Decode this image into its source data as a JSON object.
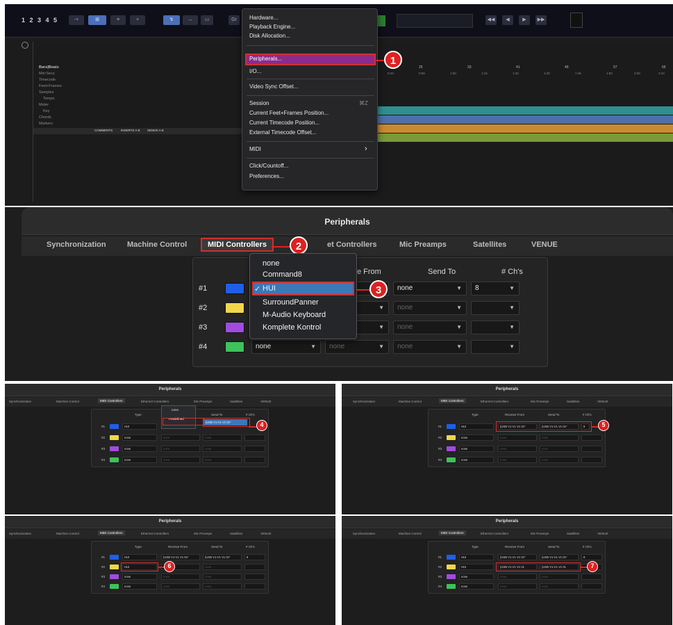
{
  "panel1": {
    "transport_numbers": "1 2 3 4 5",
    "ruler_labels": [
      "Bars|Beats",
      "Min:Secs",
      "Timecode",
      "Feet+Frames",
      "Samples",
      "Tempo",
      "Meter",
      "Key",
      "Chords",
      "Markers"
    ],
    "ruler_values": [
      "25",
      "33",
      "41",
      "49",
      "57",
      "65"
    ],
    "time_values": [
      "0:43",
      "0:59",
      "1:00",
      "1:15",
      "1:20",
      "1:30",
      "1:45",
      "1:50",
      "2:00",
      "2:10"
    ],
    "bottom_buttons": [
      "COMMENTS",
      "INSERTS A-E",
      "SENDS A-E"
    ],
    "setup_menu": {
      "items": [
        "Hardware...",
        "Playback Engine...",
        "Disk Allocation...",
        "Peripherals...",
        "I/O...",
        "Video Sync Offset...",
        "Session",
        "Current Feet+Frames Position...",
        "Current Timecode Position...",
        "External Timecode Offset...",
        "MIDI",
        "Click/Countoff...",
        "Preferences..."
      ],
      "session_shortcut": "⌘Z",
      "midi_arrow": "›"
    },
    "step": "1"
  },
  "panel2": {
    "title": "Peripherals",
    "tabs": [
      "Synchronization",
      "Machine Control",
      "MIDI Controllers",
      "Ethernet Controllers",
      "Mic Preamps",
      "Satellites",
      "VENUE"
    ],
    "tab_partial": "et Controllers",
    "columns": {
      "receive": "ive From",
      "send": "Send To",
      "chs": "# Ch's"
    },
    "rows": [
      {
        "label": "#1",
        "color": "#1f5fe8",
        "send": "none",
        "chs": "8"
      },
      {
        "label": "#2",
        "color": "#f0d64a",
        "send": "none",
        "chs": ""
      },
      {
        "label": "#3",
        "color": "#a24be0",
        "send": "none",
        "chs": ""
      },
      {
        "label": "#4",
        "color": "#3ec25a",
        "type": "none",
        "receive": "none",
        "send": "none",
        "chs": ""
      }
    ],
    "dropdown": [
      "none",
      "Command8",
      "HUI",
      "SurroundPanner",
      "M-Audio Keyboard",
      "Komplete Kontrol"
    ],
    "check": "✓",
    "steps": [
      "2",
      "3"
    ]
  },
  "small": {
    "title": "Peripherals",
    "tabs": [
      "Synchronization",
      "Machine Control",
      "MIDI Controllers",
      "Ethernet Controllers",
      "Mic Preamps",
      "Satellites",
      "VENUE"
    ],
    "columns": [
      "Type",
      "Receive From",
      "Send To",
      "# Ch's"
    ],
    "row_labels": [
      "#1",
      "#2",
      "#3",
      "#4"
    ],
    "none": "none",
    "hui": "HUI",
    "port": "(USB V1-V1 V1 01*",
    "port2": "(USB V1-V1 V1 01",
    "predefined": "Predefined",
    "chs": "8",
    "steps": [
      "4",
      "5",
      "6",
      "7"
    ]
  }
}
